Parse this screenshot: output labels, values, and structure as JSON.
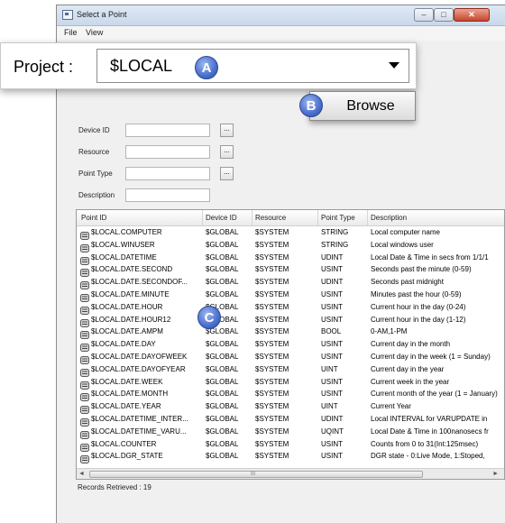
{
  "window": {
    "title": "Select a Point"
  },
  "menu": [
    "File",
    "View"
  ],
  "project": {
    "label": "Project :",
    "value": "$LOCAL"
  },
  "markers": {
    "a": "A",
    "b": "B",
    "c": "C"
  },
  "browse_label": "Browse",
  "filters": [
    {
      "label": "Device ID",
      "button": "..."
    },
    {
      "label": "Resource",
      "button": "..."
    },
    {
      "label": "Point Type",
      "button": "..."
    },
    {
      "label": "Description"
    }
  ],
  "table": {
    "columns": [
      "Point ID",
      "Device ID",
      "Resource",
      "Point Type",
      "Description"
    ],
    "rows": [
      [
        "$LOCAL.COMPUTER",
        "$GLOBAL",
        "$SYSTEM",
        "STRING",
        "Local computer name"
      ],
      [
        "$LOCAL.WINUSER",
        "$GLOBAL",
        "$SYSTEM",
        "STRING",
        "Local windows user"
      ],
      [
        "$LOCAL.DATETIME",
        "$GLOBAL",
        "$SYSTEM",
        "UDINT",
        "Local Date & Time in secs from 1/1/1"
      ],
      [
        "$LOCAL.DATE.SECOND",
        "$GLOBAL",
        "$SYSTEM",
        "USINT",
        "Seconds past the minute (0-59)"
      ],
      [
        "$LOCAL.DATE.SECONDOF...",
        "$GLOBAL",
        "$SYSTEM",
        "UDINT",
        "Seconds past midnight"
      ],
      [
        "$LOCAL.DATE.MINUTE",
        "$GLOBAL",
        "$SYSTEM",
        "USINT",
        "Minutes past the hour (0-59)"
      ],
      [
        "$LOCAL.DATE.HOUR",
        "$GLOBAL",
        "$SYSTEM",
        "USINT",
        "Current hour in the day (0-24)"
      ],
      [
        "$LOCAL.DATE.HOUR12",
        "$GLOBAL",
        "$SYSTEM",
        "USINT",
        "Current hour in the day (1-12)"
      ],
      [
        "$LOCAL.DATE.AMPM",
        "$GLOBAL",
        "$SYSTEM",
        "BOOL",
        "0-AM,1-PM"
      ],
      [
        "$LOCAL.DATE.DAY",
        "$GLOBAL",
        "$SYSTEM",
        "USINT",
        "Current day in the month"
      ],
      [
        "$LOCAL.DATE.DAYOFWEEK",
        "$GLOBAL",
        "$SYSTEM",
        "USINT",
        "Current day in the week (1 = Sunday)"
      ],
      [
        "$LOCAL.DATE.DAYOFYEAR",
        "$GLOBAL",
        "$SYSTEM",
        "UINT",
        "Current day in the year"
      ],
      [
        "$LOCAL.DATE.WEEK",
        "$GLOBAL",
        "$SYSTEM",
        "USINT",
        "Current week in the year"
      ],
      [
        "$LOCAL.DATE.MONTH",
        "$GLOBAL",
        "$SYSTEM",
        "USINT",
        "Current month of the year (1 = January)"
      ],
      [
        "$LOCAL.DATE.YEAR",
        "$GLOBAL",
        "$SYSTEM",
        "UINT",
        "Current Year"
      ],
      [
        "$LOCAL.DATETIME_INTER...",
        "$GLOBAL",
        "$SYSTEM",
        "UDINT",
        "Local INTERVAL for VARUPDATE in"
      ],
      [
        "$LOCAL.DATETIME_VARU...",
        "$GLOBAL",
        "$SYSTEM",
        "UQINT",
        "Local Date & Time in 100nanosecs fr"
      ],
      [
        "$LOCAL.COUNTER",
        "$GLOBAL",
        "$SYSTEM",
        "USINT",
        "Counts from 0 to 31(Int:125msec)"
      ],
      [
        "$LOCAL.DGR_STATE",
        "$GLOBAL",
        "$SYSTEM",
        "USINT",
        "DGR state - 0:Live Mode, 1:Stoped,"
      ]
    ]
  },
  "scrollbar": {
    "left": "◄",
    "right": "►",
    "grip": "III"
  },
  "status": "Records Retrieved : 19"
}
